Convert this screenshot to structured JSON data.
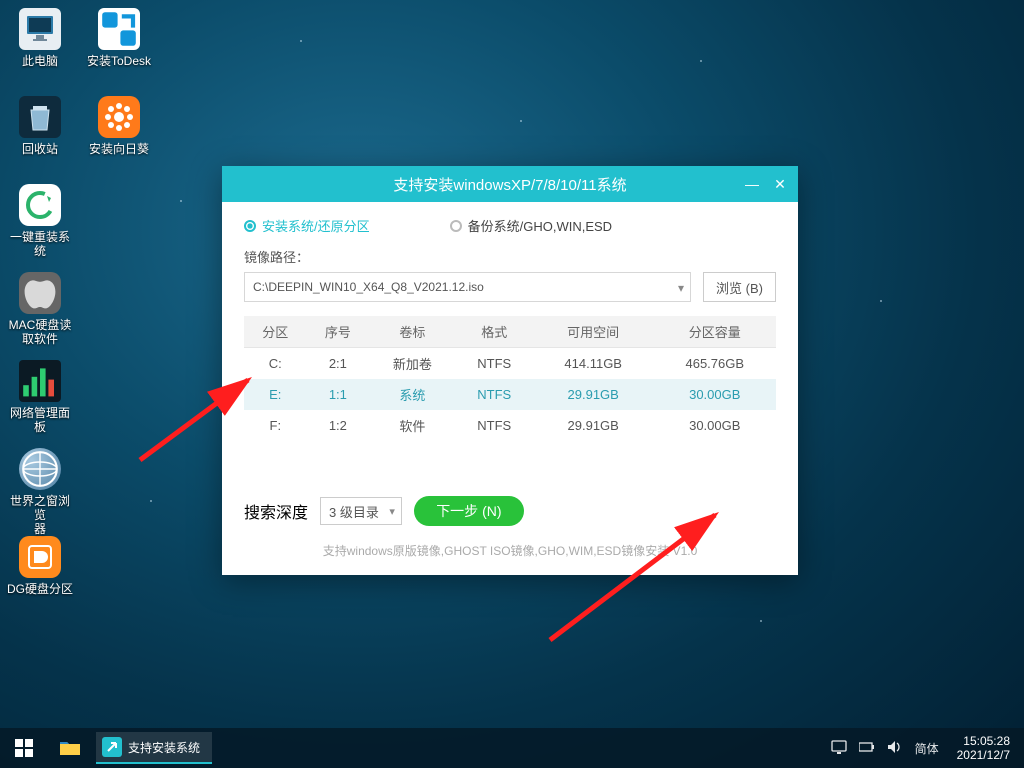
{
  "desktop_icons_col1": [
    {
      "name": "pc",
      "label": "此电脑"
    },
    {
      "name": "bin",
      "label": "回收站"
    },
    {
      "name": "reinstall",
      "label": "一键重装系统"
    },
    {
      "name": "macread",
      "label": "MAC硬盘读\n取软件"
    },
    {
      "name": "netpanel",
      "label": "网络管理面板"
    },
    {
      "name": "browser",
      "label": "世界之窗浏览\n器"
    },
    {
      "name": "dgdisk",
      "label": "DG硬盘分区"
    }
  ],
  "desktop_icons_col2": [
    {
      "name": "todesk",
      "label": "安装ToDesk"
    },
    {
      "name": "sunflower",
      "label": "安装向日葵"
    }
  ],
  "window": {
    "title": "支持安装windowsXP/7/8/10/11系统",
    "radio_install": "安装系统/还原分区",
    "radio_backup": "备份系统/GHO,WIN,ESD",
    "path_label": "镜像路径：",
    "path_value": "C:\\DEEPIN_WIN10_X64_Q8_V2021.12.iso",
    "browse": "浏览 (B)",
    "columns": [
      "分区",
      "序号",
      "卷标",
      "格式",
      "可用空间",
      "分区容量"
    ],
    "rows": [
      {
        "part": "C:",
        "idx": "2:1",
        "vol": "新加卷",
        "fs": "NTFS",
        "free": "414.11GB",
        "cap": "465.76GB",
        "selected": false
      },
      {
        "part": "E:",
        "idx": "1:1",
        "vol": "系统",
        "fs": "NTFS",
        "free": "29.91GB",
        "cap": "30.00GB",
        "selected": true
      },
      {
        "part": "F:",
        "idx": "1:2",
        "vol": "软件",
        "fs": "NTFS",
        "free": "29.91GB",
        "cap": "30.00GB",
        "selected": false
      }
    ],
    "search_label": "搜索深度",
    "search_value": "3 级目录",
    "next": "下一步 (N)",
    "support": "支持windows原版镜像,GHOST ISO镜像,GHO,WIM,ESD镜像安装    V1.0"
  },
  "taskbar": {
    "task_label": "支持安装系统",
    "ime": "简体",
    "time": "15:05:28",
    "date": "2021/12/7"
  }
}
